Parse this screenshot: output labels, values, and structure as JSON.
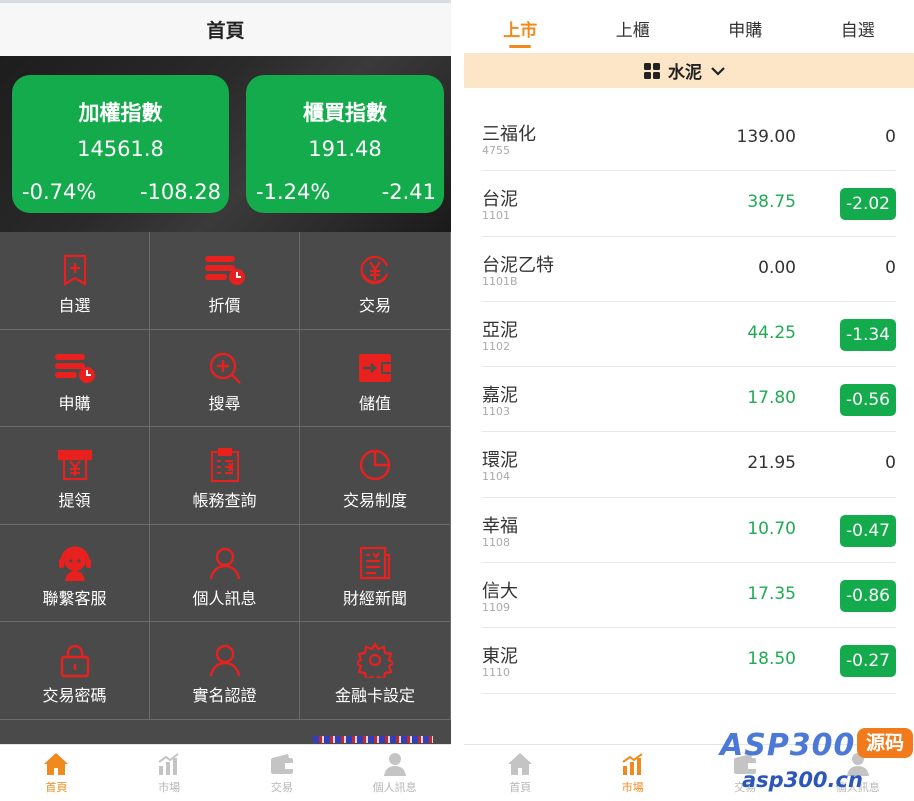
{
  "home": {
    "title": "首頁",
    "indices": [
      {
        "name": "加權指數",
        "value": "14561.8",
        "percent": "-0.74%",
        "change": "-108.28"
      },
      {
        "name": "櫃買指數",
        "value": "191.48",
        "percent": "-1.24%",
        "change": "-2.41"
      }
    ],
    "menu": [
      {
        "label": "自選",
        "icon": "bookmark-icon"
      },
      {
        "label": "折價",
        "icon": "discount-icon"
      },
      {
        "label": "交易",
        "icon": "yen-exchange-icon"
      },
      {
        "label": "申購",
        "icon": "subscribe-icon"
      },
      {
        "label": "搜尋",
        "icon": "search-icon"
      },
      {
        "label": "儲值",
        "icon": "wallet-icon"
      },
      {
        "label": "提領",
        "icon": "atm-icon"
      },
      {
        "label": "帳務查詢",
        "icon": "ledger-icon"
      },
      {
        "label": "交易制度",
        "icon": "pie-icon"
      },
      {
        "label": "聯繫客服",
        "icon": "headset-icon"
      },
      {
        "label": "個人訊息",
        "icon": "user-icon"
      },
      {
        "label": "財經新聞",
        "icon": "news-icon"
      },
      {
        "label": "交易密碼",
        "icon": "lock-icon"
      },
      {
        "label": "實名認證",
        "icon": "user-verify-icon"
      },
      {
        "label": "金融卡設定",
        "icon": "gear-icon"
      }
    ],
    "tabbar": [
      {
        "label": "首頁",
        "icon": "home-icon"
      },
      {
        "label": "市場",
        "icon": "chart-icon"
      },
      {
        "label": "交易",
        "icon": "wallet-icon"
      },
      {
        "label": "個人訊息",
        "icon": "user-icon"
      }
    ]
  },
  "market": {
    "tabs": [
      "上市",
      "上櫃",
      "申購",
      "自選"
    ],
    "sector": "水泥",
    "stocks": [
      {
        "name": "三福化",
        "code": "4755",
        "price": "139.00",
        "change": "0"
      },
      {
        "name": "台泥",
        "code": "1101",
        "price": "38.75",
        "change": "-2.02"
      },
      {
        "name": "台泥乙特",
        "code": "1101B",
        "price": "0.00",
        "change": "0"
      },
      {
        "name": "亞泥",
        "code": "1102",
        "price": "44.25",
        "change": "-1.34"
      },
      {
        "name": "嘉泥",
        "code": "1103",
        "price": "17.80",
        "change": "-0.56"
      },
      {
        "name": "環泥",
        "code": "1104",
        "price": "21.95",
        "change": "0"
      },
      {
        "name": "幸福",
        "code": "1108",
        "price": "10.70",
        "change": "-0.47"
      },
      {
        "name": "信大",
        "code": "1109",
        "price": "17.35",
        "change": "-0.86"
      },
      {
        "name": "東泥",
        "code": "1110",
        "price": "18.50",
        "change": "-0.27"
      }
    ],
    "tabbar": [
      {
        "label": "首頁",
        "icon": "home-icon"
      },
      {
        "label": "市場",
        "icon": "chart-icon"
      },
      {
        "label": "交易",
        "icon": "wallet-icon"
      },
      {
        "label": "個人訊息",
        "icon": "user-icon"
      }
    ]
  },
  "watermark": {
    "brand": "ASP300",
    "badge": "源码",
    "domain": "asp300.cn"
  },
  "colors": {
    "accent": "#f08a1c",
    "green": "#14ab4c",
    "icon_red": "#e8211f",
    "grid_bg": "#4a4a4a",
    "sector_bg": "#fde6c8"
  }
}
